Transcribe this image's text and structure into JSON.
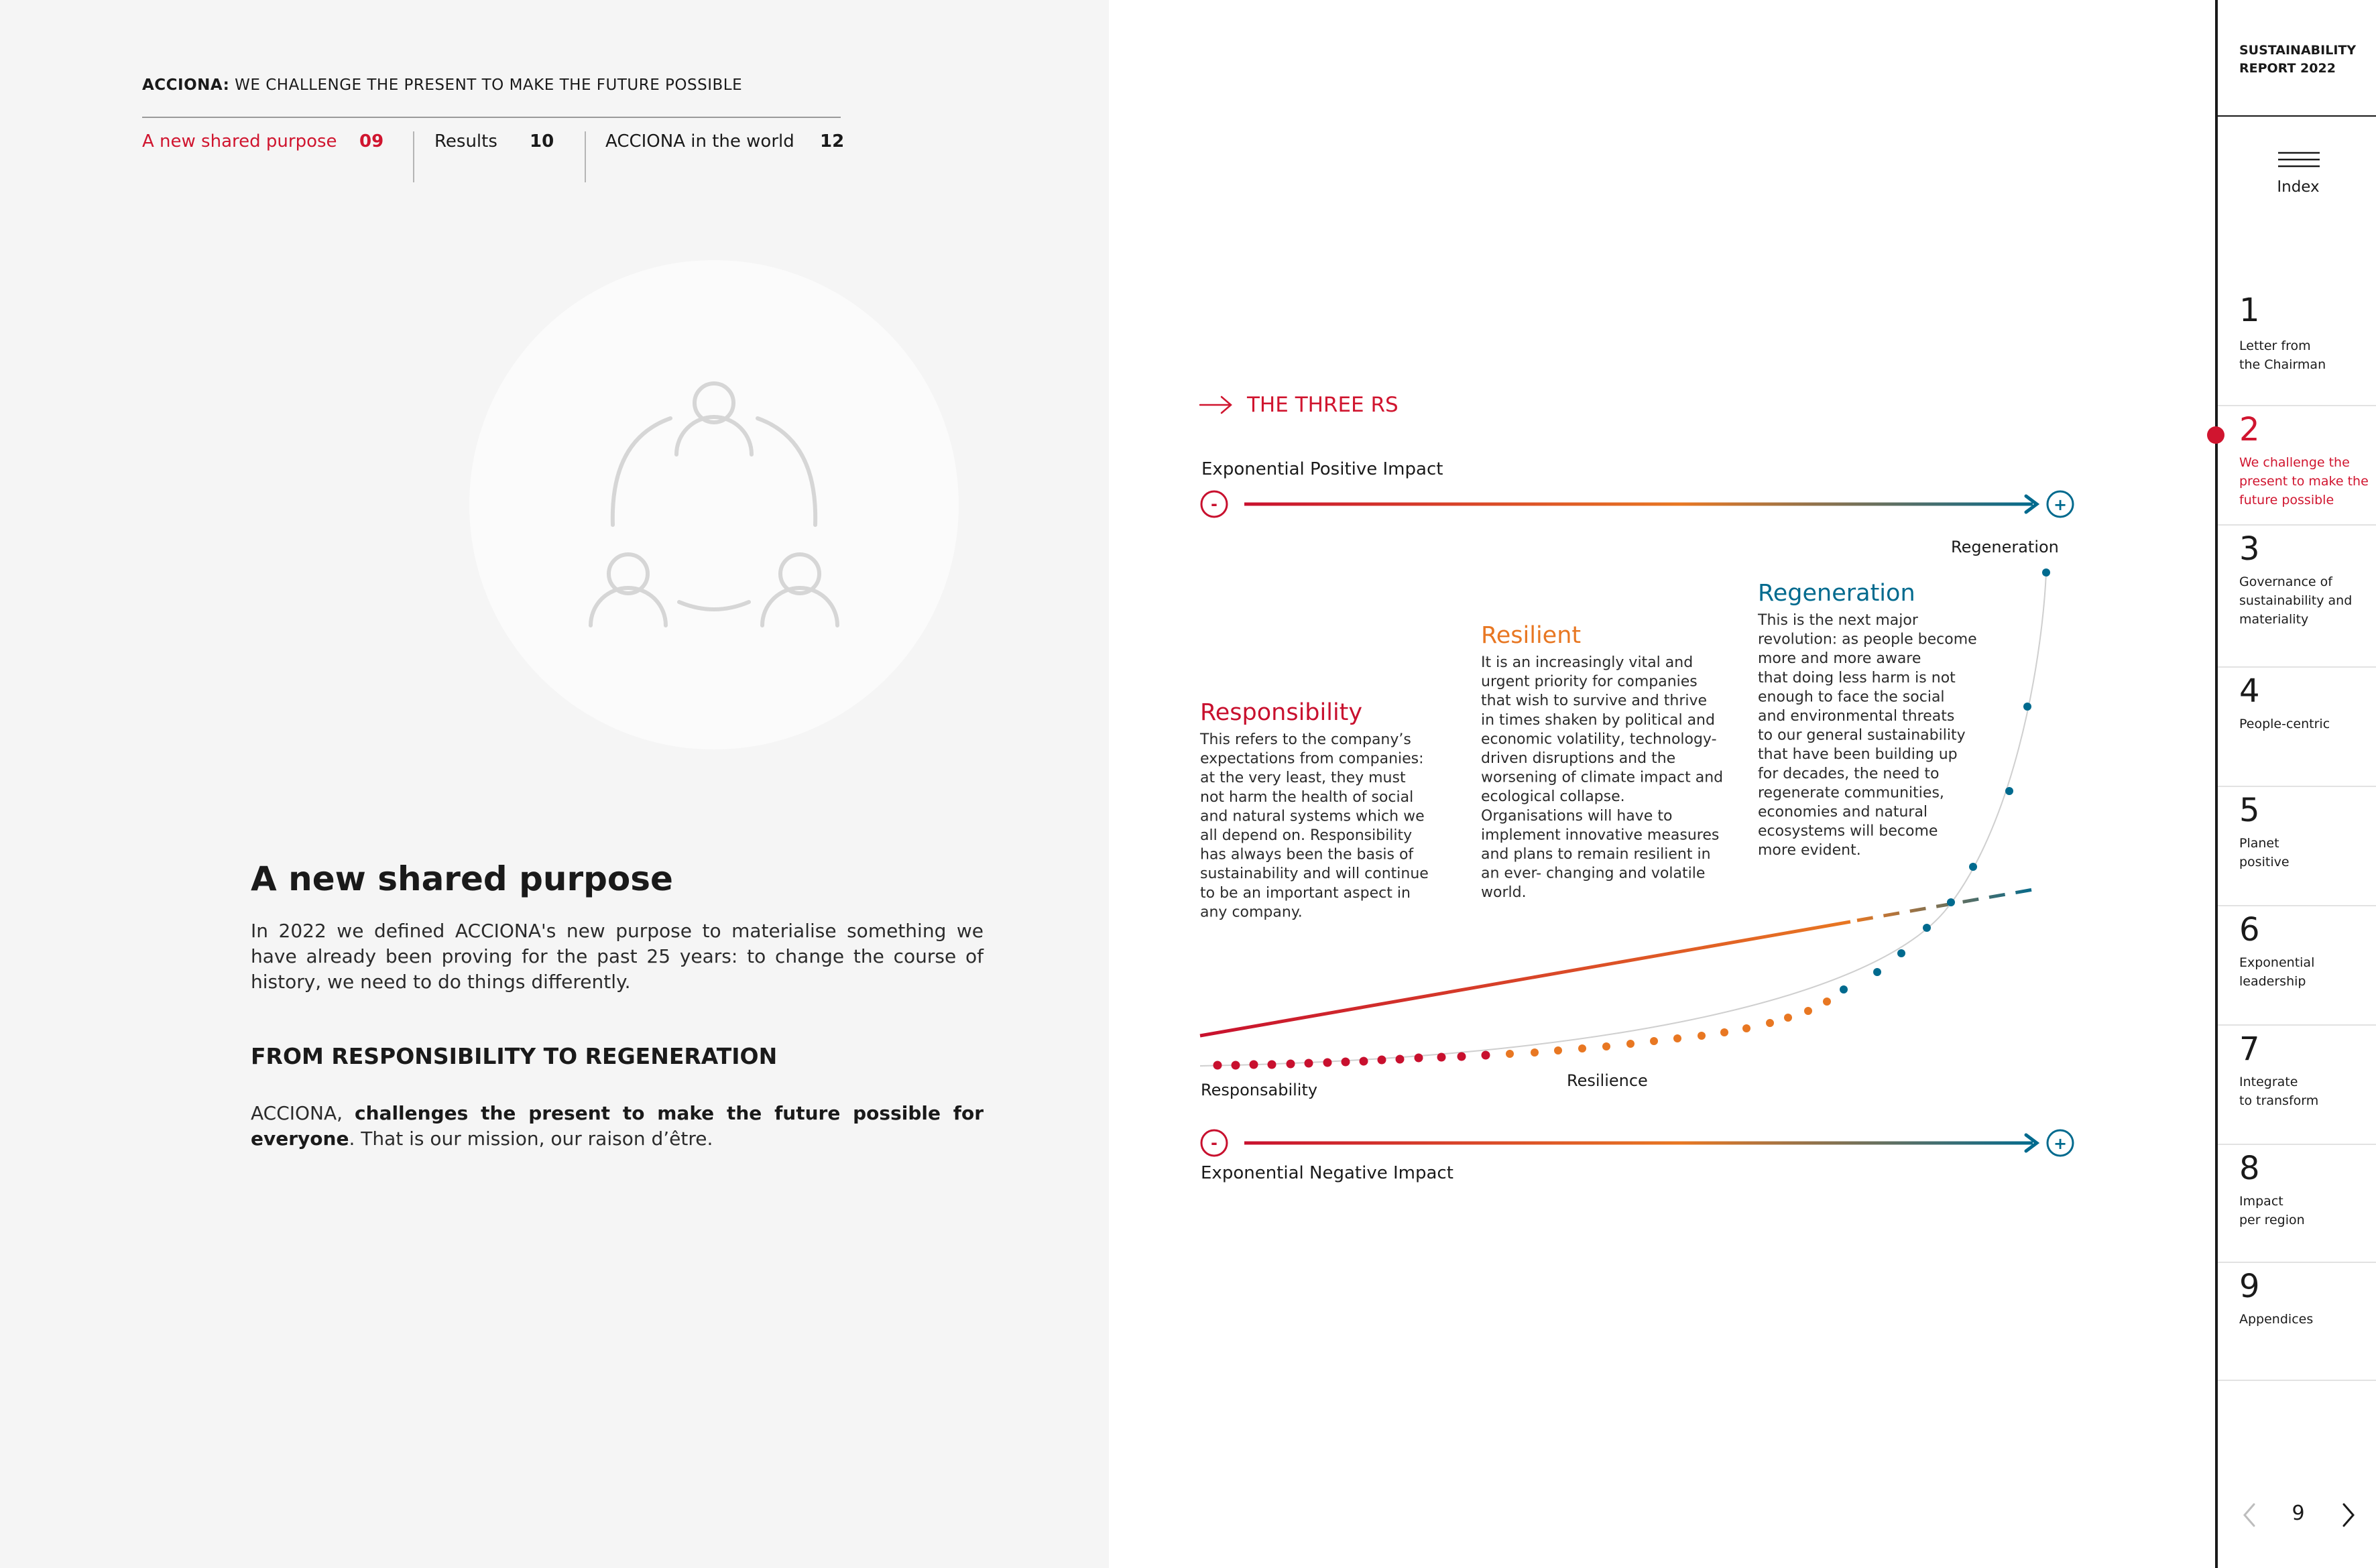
{
  "header": {
    "brand": "ACCIONA:",
    "tagline": "WE CHALLENGE THE PRESENT TO MAKE THE FUTURE POSSIBLE",
    "tabs": [
      {
        "label": "A new shared purpose",
        "page": "09",
        "active": true
      },
      {
        "label": "Results",
        "page": "10",
        "active": false
      },
      {
        "label": "ACCIONA in the world",
        "page": "12",
        "active": false
      }
    ]
  },
  "hero_icon": "people-circle-icon",
  "content": {
    "title": "A new shared purpose",
    "intro": "In 2022 we defined ACCIONA's new purpose to materialise something we have already been proving for the past 25 years: to change the course of history, we need to do things differently.",
    "subtitle": "FROM RESPONSIBILITY TO REGENERATION",
    "mission_pre": "ACCIONA, ",
    "mission_bold": "challenges the present to make the future possible for everyone",
    "mission_post": ". That is our mission, our raison d’être."
  },
  "diagram": {
    "section_title": "THE THREE RS",
    "top_label": "Exponential Positive Impact",
    "bottom_label": "Exponential Negative Impact",
    "minus_symbol": "-",
    "plus_symbol": "+",
    "curve_labels": {
      "responsability": "Responsability",
      "resilience": "Resilience",
      "regeneration": "Regeneration"
    },
    "blocks": {
      "responsibility": {
        "title": "Responsibility",
        "lines": [
          "This refers to the company’s",
          "expectations from companies:",
          "at the very least, they must",
          "not harm the health of social",
          "and natural systems which we",
          "all depend on. Responsibility",
          "has always been the basis of",
          "sustainability and will continue",
          "to be an important aspect in",
          "any company."
        ]
      },
      "resilient": {
        "title": "Resilient",
        "lines": [
          "It is an increasingly vital and",
          "urgent priority for companies",
          "that wish to survive and thrive",
          "in times shaken by political and",
          "economic volatility, technology-",
          "driven disruptions and the",
          "worsening of climate impact and",
          "ecological collapse.",
          "Organisations will have to",
          "implement innovative measures",
          "and plans to remain resilient in",
          "an ever- changing and volatile",
          "world."
        ]
      },
      "regeneration": {
        "title": "Regeneration",
        "lines": [
          "This is the next major",
          "revolution: as people become",
          "more and more aware",
          "that doing less harm is not",
          "enough to face the social",
          "and environmental threats",
          "to our general sustainability",
          "that have been building up",
          "for decades, the need to",
          "regenerate communities,",
          "economies and natural",
          "ecosystems will become",
          "more evident."
        ]
      }
    },
    "colors": {
      "red": "#c8102e",
      "orange": "#e87722",
      "blue": "#006a8e"
    }
  },
  "sidebar": {
    "report_title_1": "SUSTAINABILITY",
    "report_title_2": "REPORT 2022",
    "index_label": "Index",
    "items": [
      {
        "num": "1",
        "label": "Letter from\nthe Chairman"
      },
      {
        "num": "2",
        "label": "We challenge the\npresent to make the\nfuture possible",
        "active": true
      },
      {
        "num": "3",
        "label": "Governance of\nsustainability and\nmateriality"
      },
      {
        "num": "4",
        "label": "People-centric"
      },
      {
        "num": "5",
        "label": "Planet\npositive"
      },
      {
        "num": "6",
        "label": "Exponential\nleadership"
      },
      {
        "num": "7",
        "label": "Integrate\nto transform"
      },
      {
        "num": "8",
        "label": "Impact\nper region"
      },
      {
        "num": "9",
        "label": "Appendices"
      }
    ],
    "page_number": "9"
  }
}
